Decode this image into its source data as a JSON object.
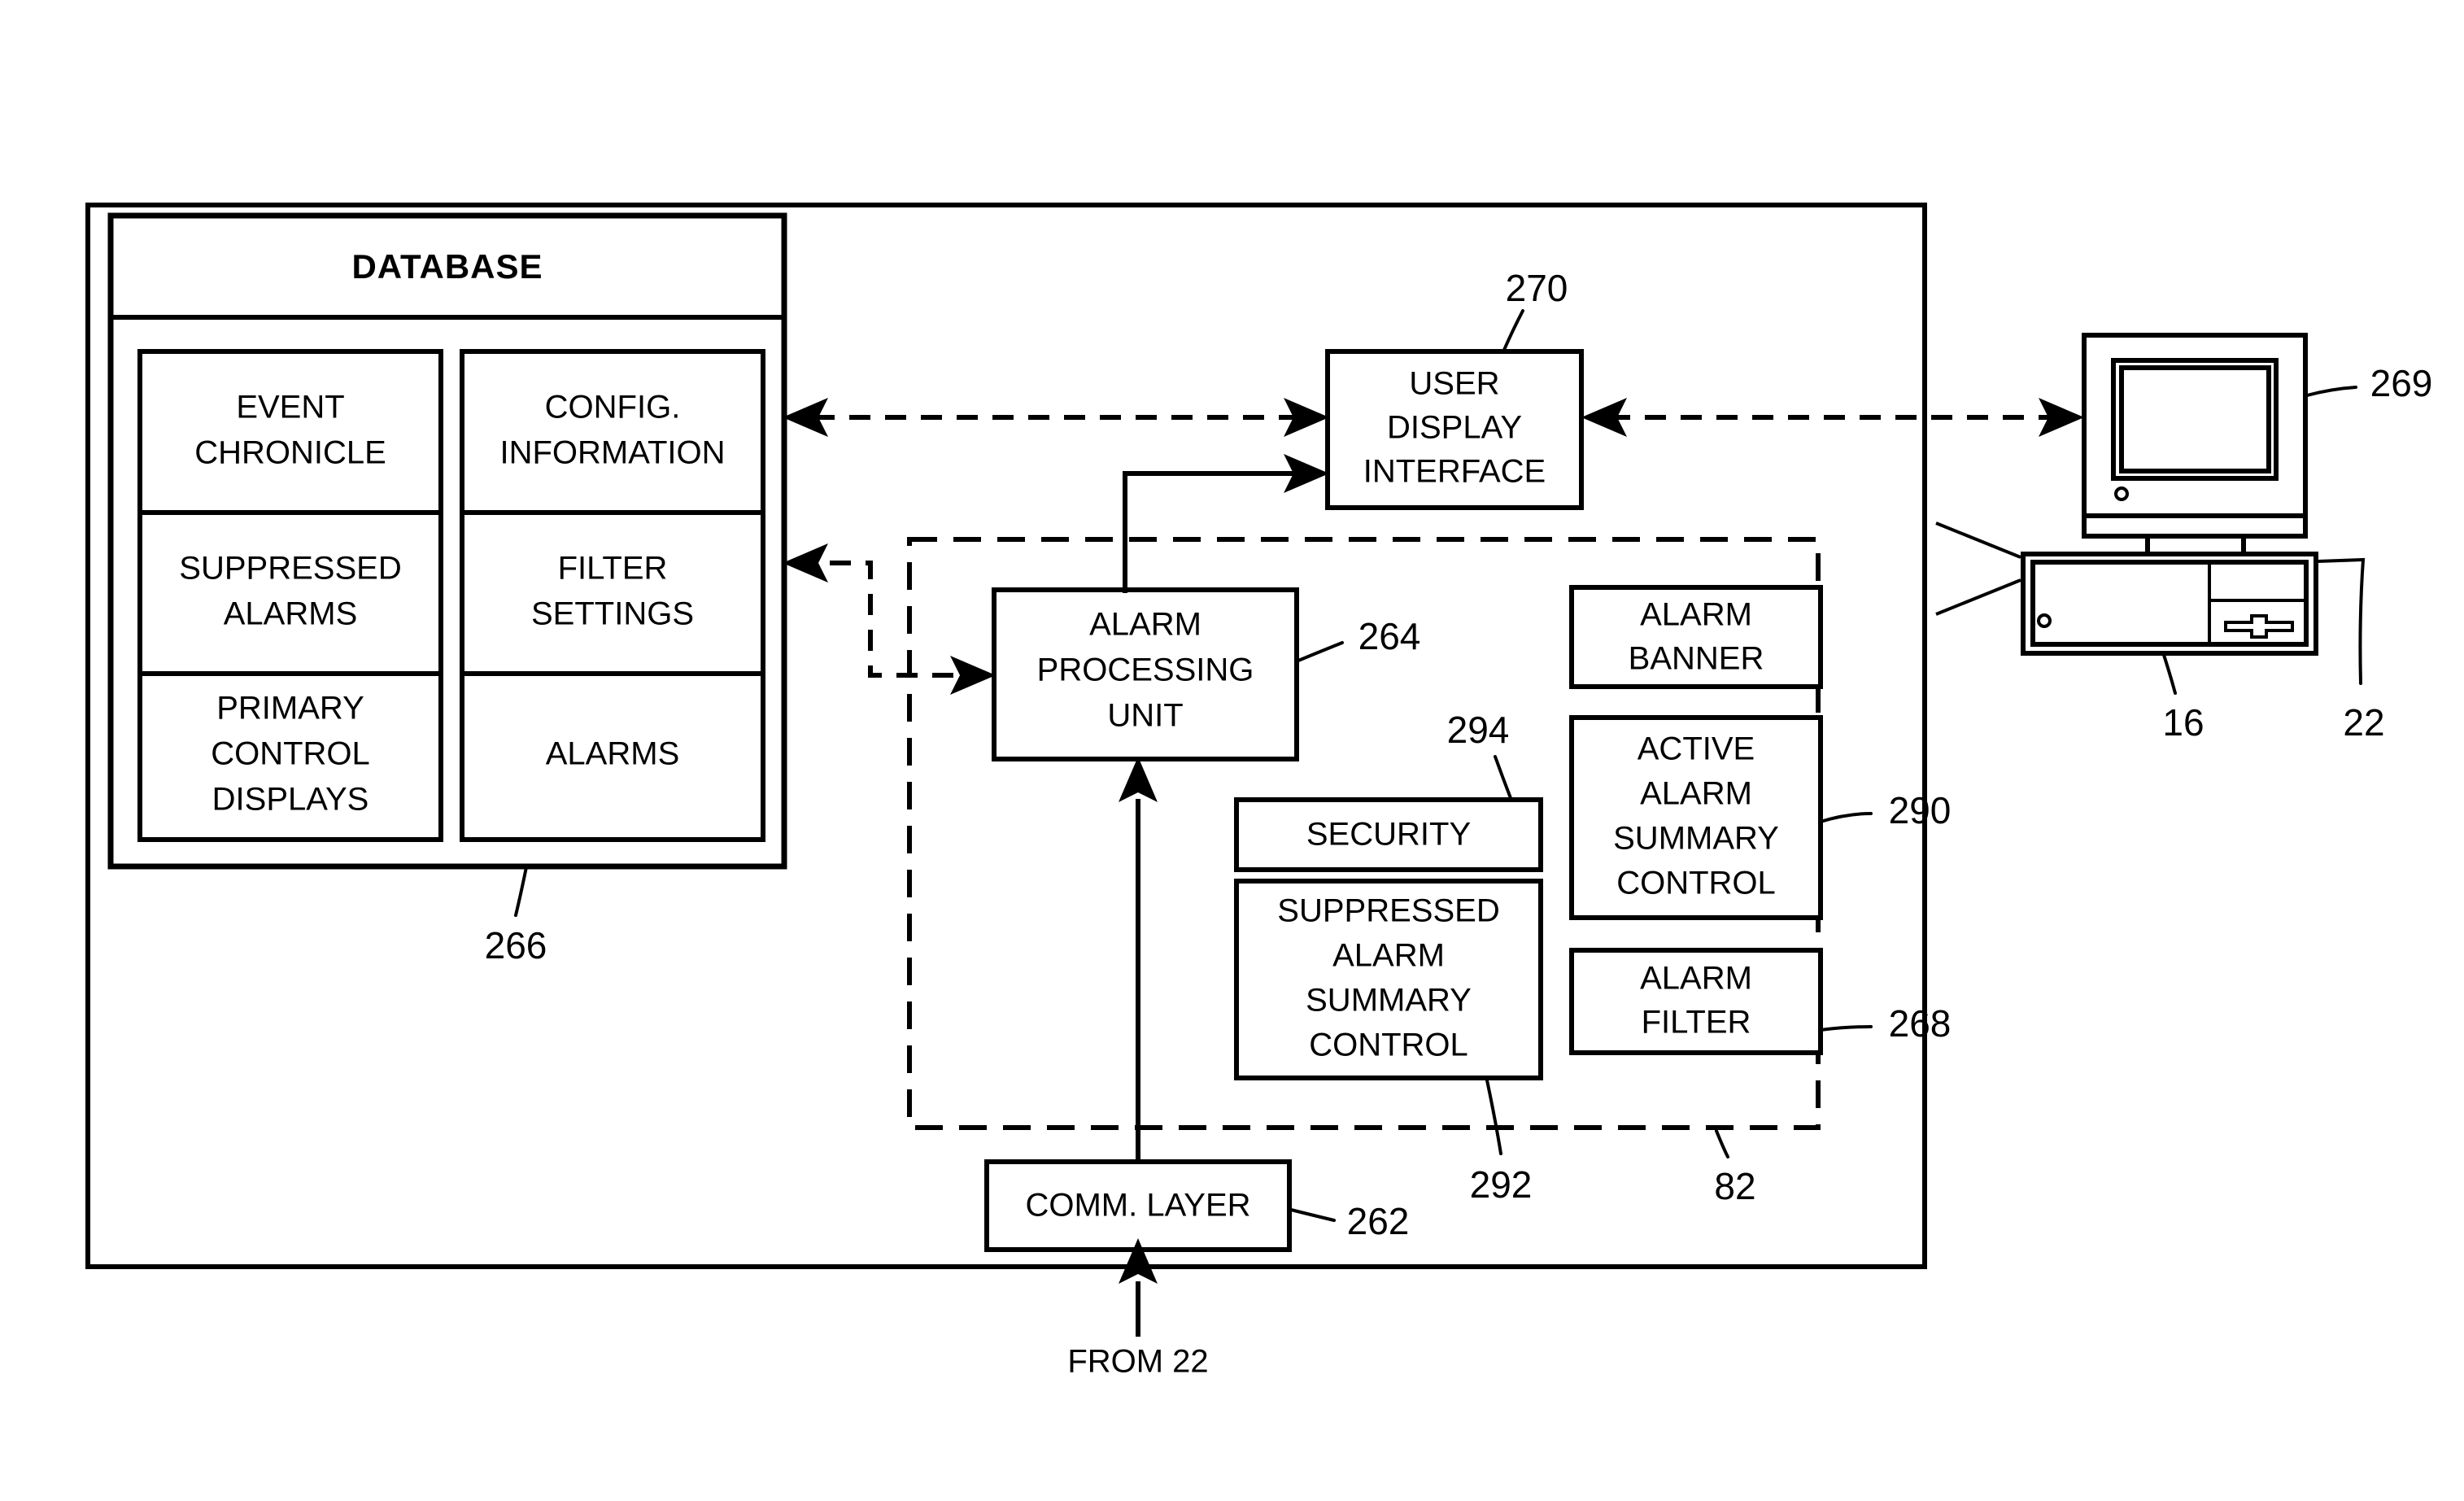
{
  "figure": {
    "type": "patent-block-diagram",
    "database_panel": {
      "title": "DATABASE",
      "reference": "266",
      "cells": [
        {
          "label": "EVENT CHRONICLE",
          "lines": [
            "EVENT",
            "CHRONICLE"
          ]
        },
        {
          "label": "CONFIG. INFORMATION",
          "lines": [
            "CONFIG.",
            "INFORMATION"
          ]
        },
        {
          "label": "SUPPRESSED ALARMS",
          "lines": [
            "SUPPRESSED",
            "ALARMS"
          ]
        },
        {
          "label": "FILTER SETTINGS",
          "lines": [
            "FILTER",
            "SETTINGS"
          ]
        },
        {
          "label": "PRIMARY CONTROL DISPLAYS",
          "lines": [
            "PRIMARY",
            "CONTROL",
            "DISPLAYS"
          ]
        },
        {
          "label": "ALARMS",
          "lines": [
            "ALARMS"
          ]
        }
      ]
    },
    "user_display_interface": {
      "lines": [
        "USER",
        "DISPLAY",
        "INTERFACE"
      ],
      "reference": "270"
    },
    "alarm_processing_unit": {
      "lines": [
        "ALARM",
        "PROCESSING",
        "UNIT"
      ],
      "reference": "264"
    },
    "comm_layer": {
      "lines": [
        "COMM. LAYER"
      ],
      "reference": "262"
    },
    "dashed_group": {
      "reference": "82",
      "modules": [
        {
          "name": "security",
          "lines": [
            "SECURITY"
          ],
          "reference": "294"
        },
        {
          "name": "suppressed-alarm-summary-control",
          "lines": [
            "SUPPRESSED",
            "ALARM",
            "SUMMARY",
            "CONTROL"
          ],
          "reference": "292"
        },
        {
          "name": "alarm-banner",
          "lines": [
            "ALARM",
            "BANNER"
          ],
          "reference": ""
        },
        {
          "name": "active-alarm-summary-control",
          "lines": [
            "ACTIVE",
            "ALARM",
            "SUMMARY",
            "CONTROL"
          ],
          "reference": "290"
        },
        {
          "name": "alarm-filter",
          "lines": [
            "ALARM",
            "FILTER"
          ],
          "reference": "268"
        }
      ]
    },
    "workstation": {
      "monitor_reference": "269",
      "tower_reference": "16",
      "node_reference": "22"
    },
    "flow_labels": {
      "from_source": "FROM 22"
    }
  }
}
